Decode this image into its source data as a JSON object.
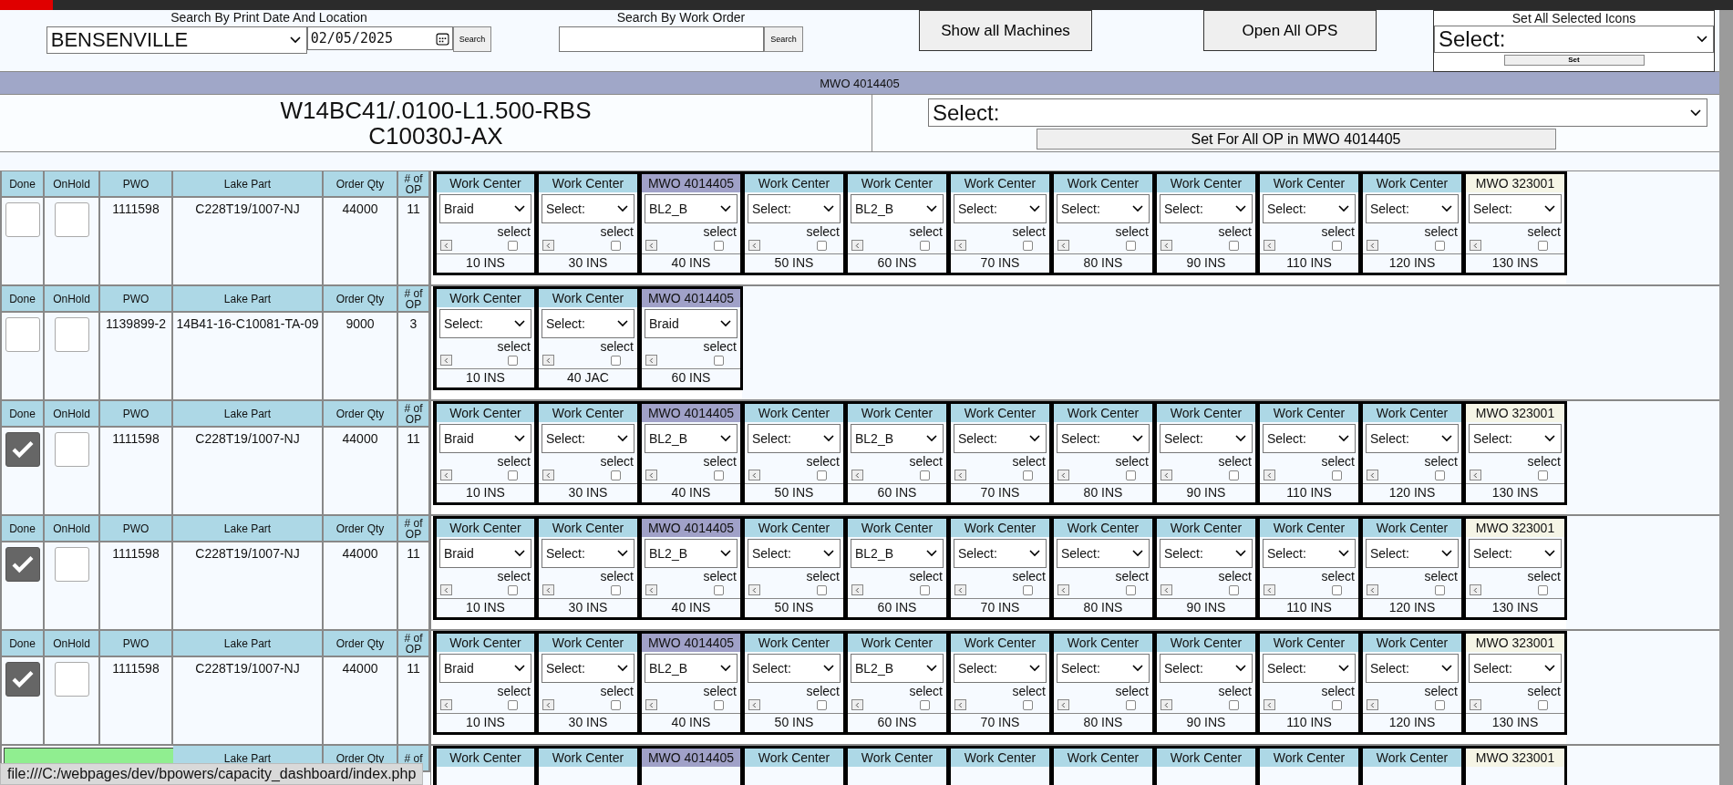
{
  "filters": {
    "location_label": "Search By Print Date And Location",
    "location": "BENSENVILLE",
    "date": "02/05/2025",
    "date_search": "Search",
    "work_order_label": "Search By Work Order",
    "work_order_search": "Search",
    "show_machines": "Show all Machines",
    "open_ops": "Open All OPS",
    "set_icons_label": "Set All Selected Icons",
    "set_icons_value": "Select:",
    "set_button": "Set"
  },
  "mwo_bar": "MWO 4014405",
  "part": {
    "title_lines": [
      "W14BC41/.0100-L1.500-RBS",
      "C10030J-AX"
    ],
    "select": "Select:",
    "set_all": "Set For All OP in MWO 4014405"
  },
  "rows": [
    {
      "kind": "order",
      "headers": [
        "Done",
        "OnHold",
        "PWO",
        "Lake Part",
        "Order Qty",
        "# of OP"
      ],
      "done": false,
      "on_hold": false,
      "pwo": "1111598",
      "lake_part": "C228T19/1007-NJ",
      "order_qty": "44000",
      "op_count": "11",
      "ops": [
        {
          "kind": "work_center",
          "header": "Work Center",
          "value": "Braid",
          "label": "select",
          "checked": false,
          "code": "10 INS"
        },
        {
          "kind": "work_center",
          "header": "Work Center",
          "value": "Select:",
          "label": "select",
          "checked": false,
          "code": "30 INS"
        },
        {
          "kind": "mwo",
          "header": "MWO 4014405",
          "value": "BL2_B",
          "label": "select",
          "checked": false,
          "code": "40 INS"
        },
        {
          "kind": "work_center",
          "header": "Work Center",
          "value": "Select:",
          "label": "select",
          "checked": false,
          "code": "50 INS"
        },
        {
          "kind": "work_center",
          "header": "Work Center",
          "value": "BL2_B",
          "label": "select",
          "checked": false,
          "code": "60 INS"
        },
        {
          "kind": "work_center",
          "header": "Work Center",
          "value": "Select:",
          "label": "select",
          "checked": false,
          "code": "70 INS"
        },
        {
          "kind": "work_center",
          "header": "Work Center",
          "value": "Select:",
          "label": "select",
          "checked": false,
          "code": "80 INS"
        },
        {
          "kind": "work_center",
          "header": "Work Center",
          "value": "Select:",
          "label": "select",
          "checked": false,
          "code": "90 INS"
        },
        {
          "kind": "work_center",
          "header": "Work Center",
          "value": "Select:",
          "label": "select",
          "checked": false,
          "code": "110 INS"
        },
        {
          "kind": "work_center",
          "header": "Work Center",
          "value": "Select:",
          "label": "select",
          "checked": false,
          "code": "120 INS"
        },
        {
          "kind": "other_mwo",
          "header": "MWO 323001",
          "value": "Select:",
          "label": "select",
          "checked": false,
          "code": "130 INS"
        }
      ]
    },
    {
      "kind": "order",
      "headers": [
        "Done",
        "OnHold",
        "PWO",
        "Lake Part",
        "Order Qty",
        "# of OP"
      ],
      "done": false,
      "on_hold": false,
      "pwo": "1139899-2",
      "lake_part": "14B41-16-C10081-TA-09",
      "order_qty": "9000",
      "op_count": "3",
      "ops": [
        {
          "kind": "work_center",
          "header": "Work Center",
          "value": "Select:",
          "label": "select",
          "checked": false,
          "code": "10 INS"
        },
        {
          "kind": "work_center",
          "header": "Work Center",
          "value": "Select:",
          "label": "select",
          "checked": false,
          "code": "40 JAC"
        },
        {
          "kind": "mwo",
          "header": "MWO 4014405",
          "value": "Braid",
          "label": "select",
          "checked": false,
          "code": "60 INS"
        }
      ]
    },
    {
      "kind": "order",
      "headers": [
        "Done",
        "OnHold",
        "PWO",
        "Lake Part",
        "Order Qty",
        "# of OP"
      ],
      "done": true,
      "on_hold": false,
      "pwo": "1111598",
      "lake_part": "C228T19/1007-NJ",
      "order_qty": "44000",
      "op_count": "11",
      "ops": [
        {
          "kind": "work_center",
          "header": "Work Center",
          "value": "Braid",
          "label": "select",
          "checked": false,
          "code": "10 INS"
        },
        {
          "kind": "work_center",
          "header": "Work Center",
          "value": "Select:",
          "label": "select",
          "checked": false,
          "code": "30 INS"
        },
        {
          "kind": "mwo",
          "header": "MWO 4014405",
          "value": "BL2_B",
          "label": "select",
          "checked": false,
          "code": "40 INS"
        },
        {
          "kind": "work_center",
          "header": "Work Center",
          "value": "Select:",
          "label": "select",
          "checked": false,
          "code": "50 INS"
        },
        {
          "kind": "work_center",
          "header": "Work Center",
          "value": "BL2_B",
          "label": "select",
          "checked": false,
          "code": "60 INS"
        },
        {
          "kind": "work_center",
          "header": "Work Center",
          "value": "Select:",
          "label": "select",
          "checked": false,
          "code": "70 INS"
        },
        {
          "kind": "work_center",
          "header": "Work Center",
          "value": "Select:",
          "label": "select",
          "checked": false,
          "code": "80 INS"
        },
        {
          "kind": "work_center",
          "header": "Work Center",
          "value": "Select:",
          "label": "select",
          "checked": false,
          "code": "90 INS"
        },
        {
          "kind": "work_center",
          "header": "Work Center",
          "value": "Select:",
          "label": "select",
          "checked": false,
          "code": "110 INS"
        },
        {
          "kind": "work_center",
          "header": "Work Center",
          "value": "Select:",
          "label": "select",
          "checked": false,
          "code": "120 INS"
        },
        {
          "kind": "other_mwo",
          "header": "MWO 323001",
          "value": "Select:",
          "label": "select",
          "checked": false,
          "code": "130 INS"
        }
      ]
    },
    {
      "kind": "order",
      "headers": [
        "Done",
        "OnHold",
        "PWO",
        "Lake Part",
        "Order Qty",
        "# of OP"
      ],
      "done": true,
      "on_hold": false,
      "pwo": "1111598",
      "lake_part": "C228T19/1007-NJ",
      "order_qty": "44000",
      "op_count": "11",
      "ops": [
        {
          "kind": "work_center",
          "header": "Work Center",
          "value": "Braid",
          "label": "select",
          "checked": false,
          "code": "10 INS"
        },
        {
          "kind": "work_center",
          "header": "Work Center",
          "value": "Select:",
          "label": "select",
          "checked": false,
          "code": "30 INS"
        },
        {
          "kind": "mwo",
          "header": "MWO 4014405",
          "value": "BL2_B",
          "label": "select",
          "checked": false,
          "code": "40 INS"
        },
        {
          "kind": "work_center",
          "header": "Work Center",
          "value": "Select:",
          "label": "select",
          "checked": false,
          "code": "50 INS"
        },
        {
          "kind": "work_center",
          "header": "Work Center",
          "value": "BL2_B",
          "label": "select",
          "checked": false,
          "code": "60 INS"
        },
        {
          "kind": "work_center",
          "header": "Work Center",
          "value": "Select:",
          "label": "select",
          "checked": false,
          "code": "70 INS"
        },
        {
          "kind": "work_center",
          "header": "Work Center",
          "value": "Select:",
          "label": "select",
          "checked": false,
          "code": "80 INS"
        },
        {
          "kind": "work_center",
          "header": "Work Center",
          "value": "Select:",
          "label": "select",
          "checked": false,
          "code": "90 INS"
        },
        {
          "kind": "work_center",
          "header": "Work Center",
          "value": "Select:",
          "label": "select",
          "checked": false,
          "code": "110 INS"
        },
        {
          "kind": "work_center",
          "header": "Work Center",
          "value": "Select:",
          "label": "select",
          "checked": false,
          "code": "120 INS"
        },
        {
          "kind": "other_mwo",
          "header": "MWO 323001",
          "value": "Select:",
          "label": "select",
          "checked": false,
          "code": "130 INS"
        }
      ]
    },
    {
      "kind": "order",
      "headers": [
        "Done",
        "OnHold",
        "PWO",
        "Lake Part",
        "Order Qty",
        "# of OP"
      ],
      "done": true,
      "on_hold": false,
      "pwo": "1111598",
      "lake_part": "C228T19/1007-NJ",
      "order_qty": "44000",
      "op_count": "11",
      "ops": [
        {
          "kind": "work_center",
          "header": "Work Center",
          "value": "Braid",
          "label": "select",
          "checked": false,
          "code": "10 INS"
        },
        {
          "kind": "work_center",
          "header": "Work Center",
          "value": "Select:",
          "label": "select",
          "checked": false,
          "code": "30 INS"
        },
        {
          "kind": "mwo",
          "header": "MWO 4014405",
          "value": "BL2_B",
          "label": "select",
          "checked": false,
          "code": "40 INS"
        },
        {
          "kind": "work_center",
          "header": "Work Center",
          "value": "Select:",
          "label": "select",
          "checked": false,
          "code": "50 INS"
        },
        {
          "kind": "work_center",
          "header": "Work Center",
          "value": "BL2_B",
          "label": "select",
          "checked": false,
          "code": "60 INS"
        },
        {
          "kind": "work_center",
          "header": "Work Center",
          "value": "Select:",
          "label": "select",
          "checked": false,
          "code": "70 INS"
        },
        {
          "kind": "work_center",
          "header": "Work Center",
          "value": "Select:",
          "label": "select",
          "checked": false,
          "code": "80 INS"
        },
        {
          "kind": "work_center",
          "header": "Work Center",
          "value": "Select:",
          "label": "select",
          "checked": false,
          "code": "90 INS"
        },
        {
          "kind": "work_center",
          "header": "Work Center",
          "value": "Select:",
          "label": "select",
          "checked": false,
          "code": "110 INS"
        },
        {
          "kind": "work_center",
          "header": "Work Center",
          "value": "Select:",
          "label": "select",
          "checked": false,
          "code": "120 INS"
        },
        {
          "kind": "other_mwo",
          "header": "MWO 323001",
          "value": "Select:",
          "label": "select",
          "checked": false,
          "code": "130 INS"
        }
      ]
    },
    {
      "kind": "save",
      "headers": [
        "Lake Part",
        "Order Qty",
        "# of"
      ],
      "ops": [
        {
          "kind": "work_center",
          "header": "Work Center"
        },
        {
          "kind": "work_center",
          "header": "Work Center"
        },
        {
          "kind": "mwo",
          "header": "MWO 4014405"
        },
        {
          "kind": "work_center",
          "header": "Work Center"
        },
        {
          "kind": "work_center",
          "header": "Work Center"
        },
        {
          "kind": "work_center",
          "header": "Work Center"
        },
        {
          "kind": "work_center",
          "header": "Work Center"
        },
        {
          "kind": "work_center",
          "header": "Work Center"
        },
        {
          "kind": "work_center",
          "header": "Work Center"
        },
        {
          "kind": "work_center",
          "header": "Work Center"
        },
        {
          "kind": "other_mwo",
          "header": "MWO 323001"
        }
      ]
    }
  ],
  "status_url": "file:///C:/webpages/dev/bpowers/capacity_dashboard/index.php"
}
